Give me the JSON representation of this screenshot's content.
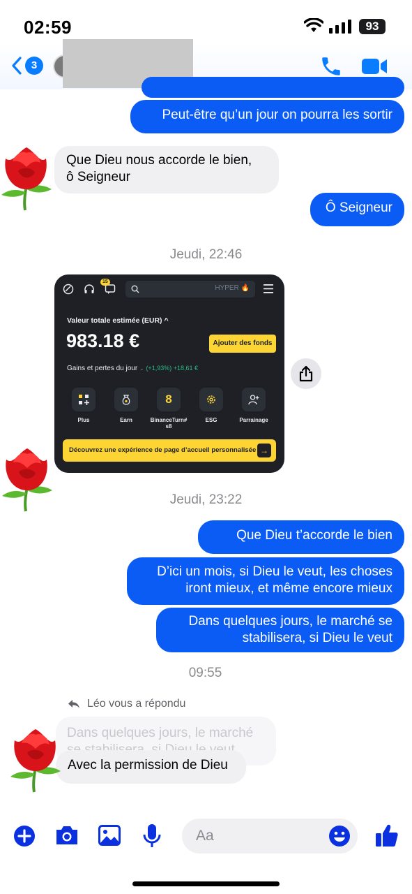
{
  "status": {
    "time": "02:59",
    "battery": "93"
  },
  "header": {
    "back_count": "3"
  },
  "messages": [
    {
      "dir": "out",
      "text": "Peut-être qu’un jour on pourra les sortir"
    },
    {
      "dir": "in",
      "line1": "Que Dieu nous accorde le bien,",
      "line2": "ô Seigneur"
    },
    {
      "dir": "out",
      "text": "Ô Seigneur"
    },
    {
      "dir": "out",
      "text": "Que Dieu t’accorde le bien"
    },
    {
      "dir": "out",
      "line1": "D’ici un mois, si Dieu le veut, les choses",
      "line2": "iront mieux, et même encore mieux"
    },
    {
      "dir": "out",
      "line1": "Dans quelques jours, le marché se",
      "line2": "stabilisera, si Dieu le veut"
    },
    {
      "dir": "in",
      "text": "Avec la permission de Dieu"
    }
  ],
  "timestamps": [
    "Jeudi, 22:46",
    "Jeudi, 23:22",
    "09:55"
  ],
  "reply": {
    "note": "Léo vous a répondu",
    "quote_line1": "Dans quelques jours, le marché",
    "quote_line2": "se stabilisera, si Dieu le veut"
  },
  "screenshot": {
    "badge": "15",
    "search_hint": "HYPER 🔥",
    "label": "Valeur totale estimée (EUR) ^",
    "amount": "983.18 €",
    "add_funds": "Ajouter des fonds",
    "pnl_label": "Gains et pertes du jour",
    "pnl_value": "(+1,93%) +18,61 €",
    "actions": [
      {
        "label": "Plus",
        "icon": "grid-plus-icon"
      },
      {
        "label": "Earn",
        "icon": "moneybag-icon"
      },
      {
        "label": "BinanceTurn#s8",
        "icon": "binance-8-icon"
      },
      {
        "label": "ESG",
        "icon": "gear-icon"
      },
      {
        "label": "Parrainage",
        "icon": "add-user-icon"
      }
    ],
    "banner": "Découvrez une expérience de page d’accueil personnalisée"
  },
  "composer": {
    "placeholder": "Aa"
  },
  "colors": {
    "accent": "#0a5cf5",
    "brand_yellow": "#fcd535",
    "card_bg": "#1e2026"
  }
}
